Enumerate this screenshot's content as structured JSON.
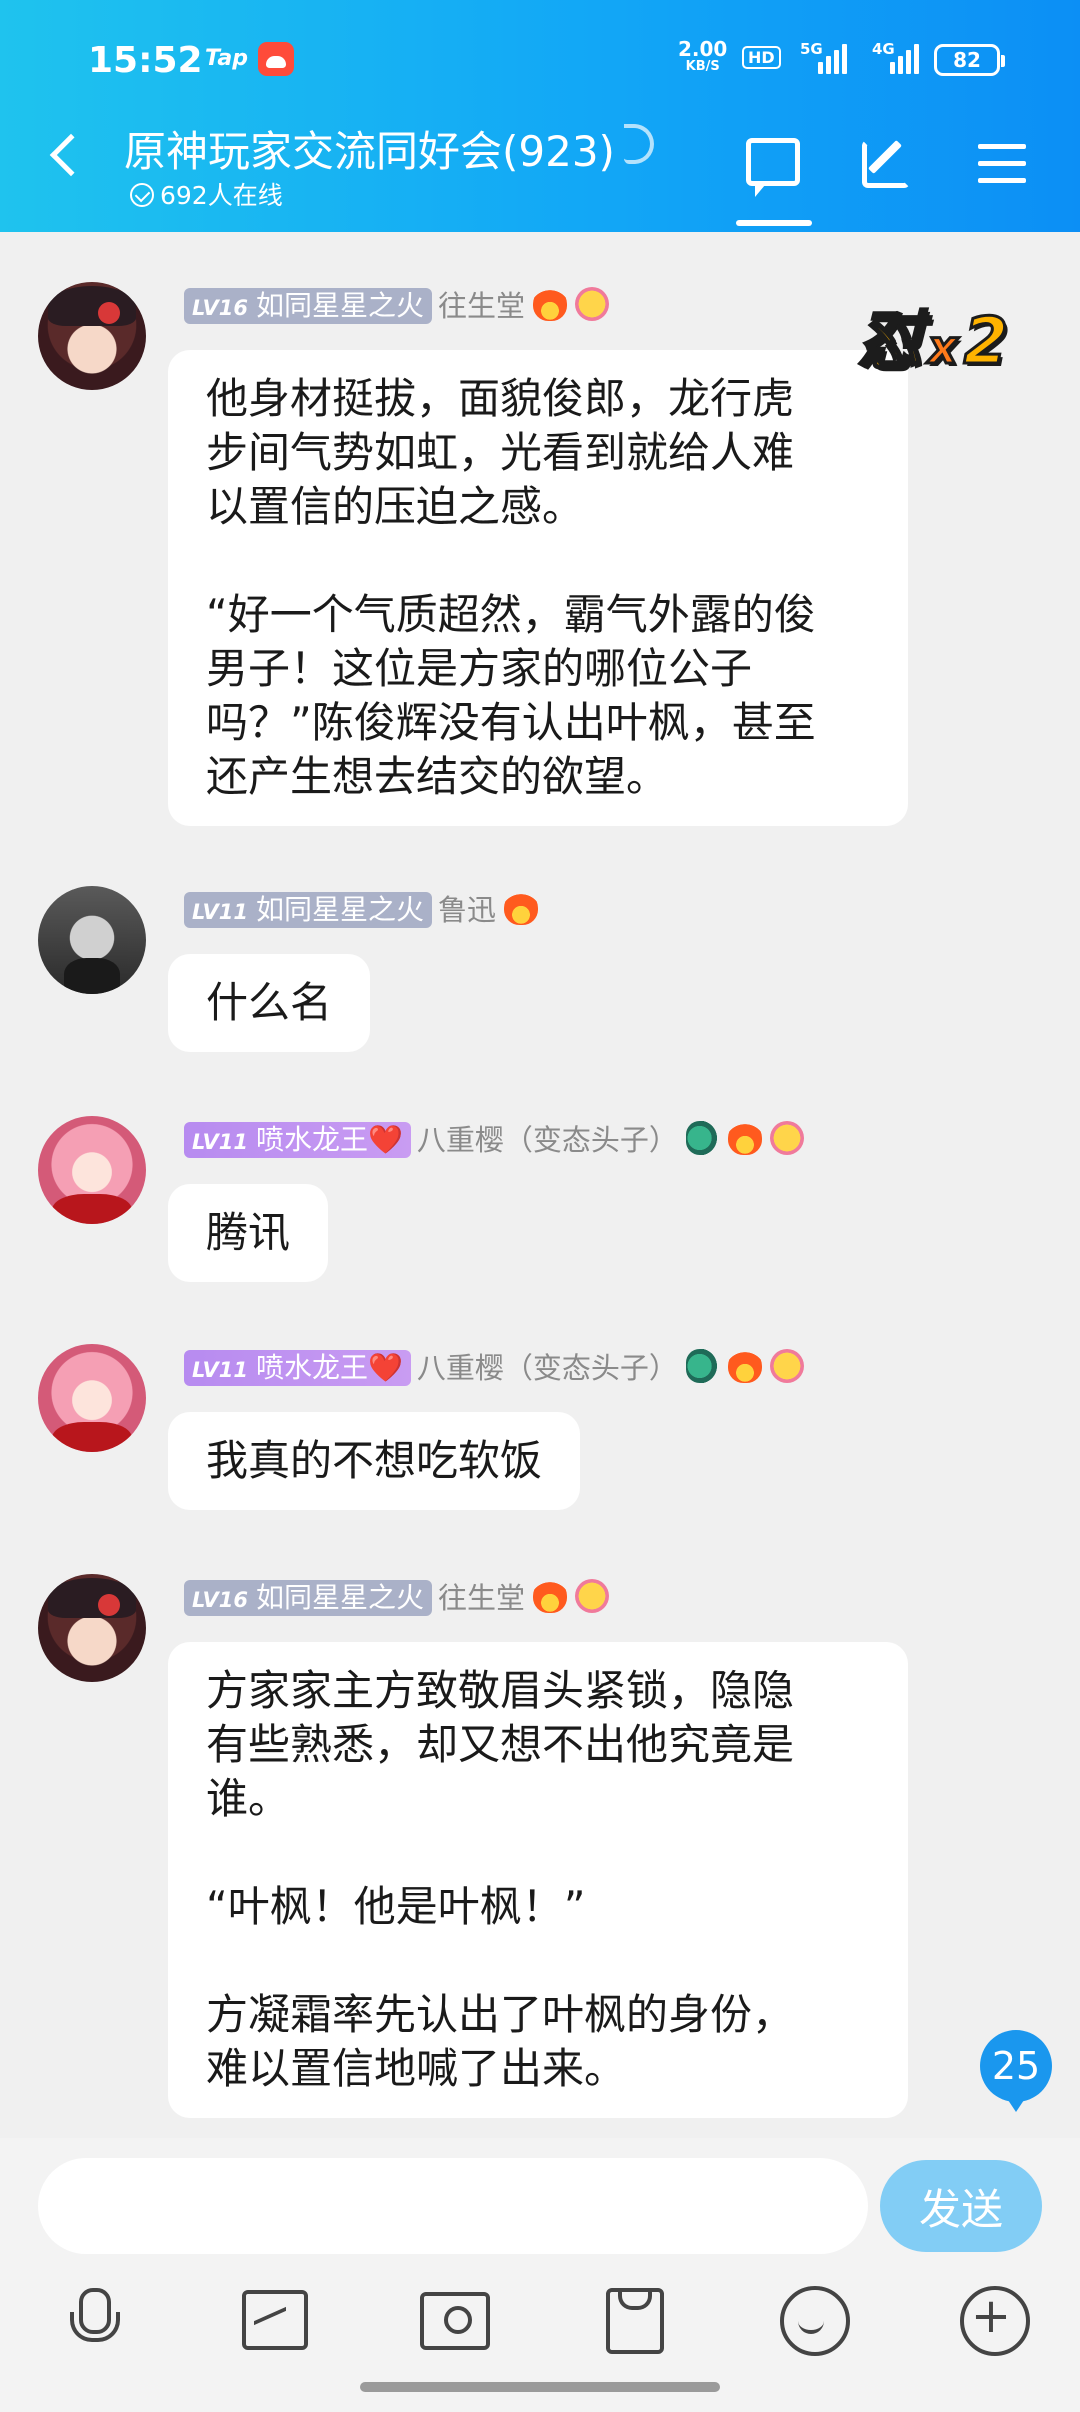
{
  "status_bar": {
    "time": "15:52",
    "tap_label": "Tap",
    "net_speed_value": "2.00",
    "net_speed_unit": "KB/S",
    "hd_label": "HD",
    "sig1_label": "5G",
    "sig2_label": "4G",
    "battery": "82"
  },
  "header": {
    "title": "原神玩家交流同好会(923)",
    "online": "692人在线"
  },
  "combo": {
    "text": "怼",
    "x": "x",
    "count": "2"
  },
  "messages": [
    {
      "level": "LV16",
      "badge": "如同星星之火",
      "name": "往生堂",
      "text": "他身材挺拔，面貌俊郎，龙行虎\n步间气势如虹，光看到就给人难\n以置信的压迫之感。\n\n“好一个气质超然，霸气外露的俊\n男子！这位是方家的哪位公子\n吗？”陈俊辉没有认出叶枫，甚至\n还产生想去结交的欲望。"
    },
    {
      "level": "LV11",
      "badge": "如同星星之火",
      "name": "鲁迅",
      "text": "什么名"
    },
    {
      "level": "LV11",
      "badge": "喷水龙王❤️",
      "name": "八重樱（变态头子）",
      "text": "腾讯"
    },
    {
      "level": "LV11",
      "badge": "喷水龙王❤️",
      "name": "八重樱（变态头子）",
      "text": "我真的不想吃软饭"
    },
    {
      "level": "LV16",
      "badge": "如同星星之火",
      "name": "往生堂",
      "text": "方家家主方致敬眉头紧锁，隐隐\n有些熟悉，却又想不出他究竟是\n谁。\n\n“叶枫！他是叶枫！”\n\n方凝霜率先认出了叶枫的身份，\n难以置信地喊了出来。"
    }
  ],
  "unread_count": "25",
  "input": {
    "placeholder": "",
    "send_label": "发送"
  },
  "icons": {
    "back": "back-arrow-icon",
    "chat": "chat-bubble-icon",
    "edit": "edit-icon",
    "menu": "hamburger-menu-icon",
    "toolbar": [
      "microphone-icon",
      "image-icon",
      "camera-icon",
      "red-packet-icon",
      "emoji-icon",
      "plus-icon"
    ]
  },
  "colors": {
    "header_gradient_start": "#1fc3ee",
    "header_gradient_end": "#0c8ff5",
    "send_button": "#82cdf5",
    "unread_badge": "#1a97ee",
    "level_badge_gray": "#aab1c8",
    "level_badge_purple": "#b78bf0"
  }
}
